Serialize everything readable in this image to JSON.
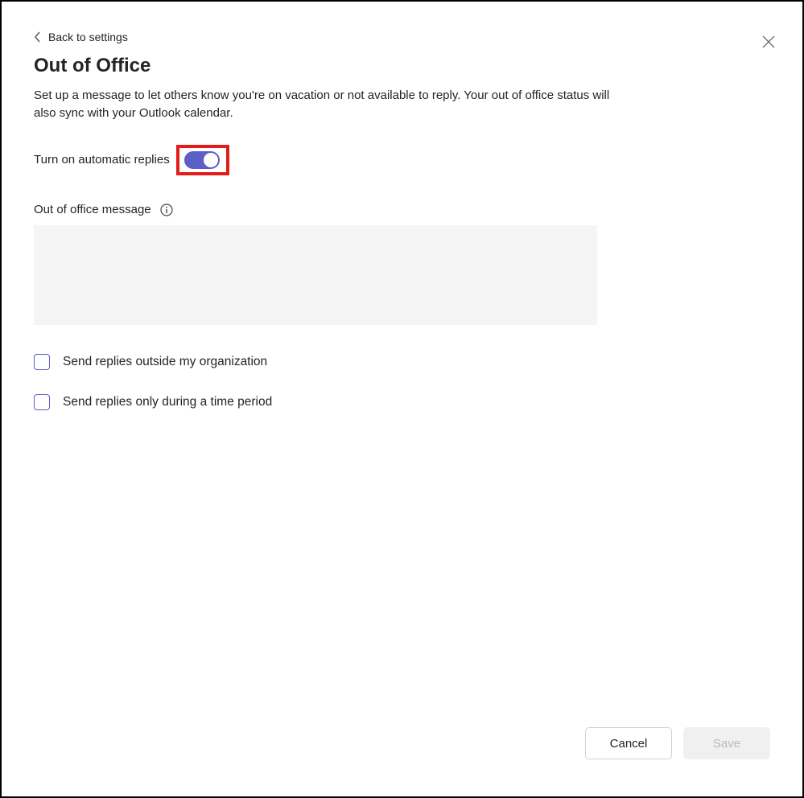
{
  "header": {
    "back_label": "Back to settings",
    "title": "Out of Office",
    "description": "Set up a message to let others know you're on vacation or not available to reply. Your out of office status will also sync with your Outlook calendar."
  },
  "toggle": {
    "label": "Turn on automatic replies",
    "on": true
  },
  "message": {
    "label": "Out of office message",
    "value": ""
  },
  "options": {
    "send_outside_label": "Send replies outside my organization",
    "send_outside_checked": false,
    "time_period_label": "Send replies only during a time period",
    "time_period_checked": false
  },
  "footer": {
    "cancel_label": "Cancel",
    "save_label": "Save"
  },
  "icons": {
    "close": "close-icon",
    "back": "chevron-left-icon",
    "info": "info-icon"
  },
  "colors": {
    "accent": "#5b5fc7",
    "highlight_border": "#e21b1b"
  }
}
